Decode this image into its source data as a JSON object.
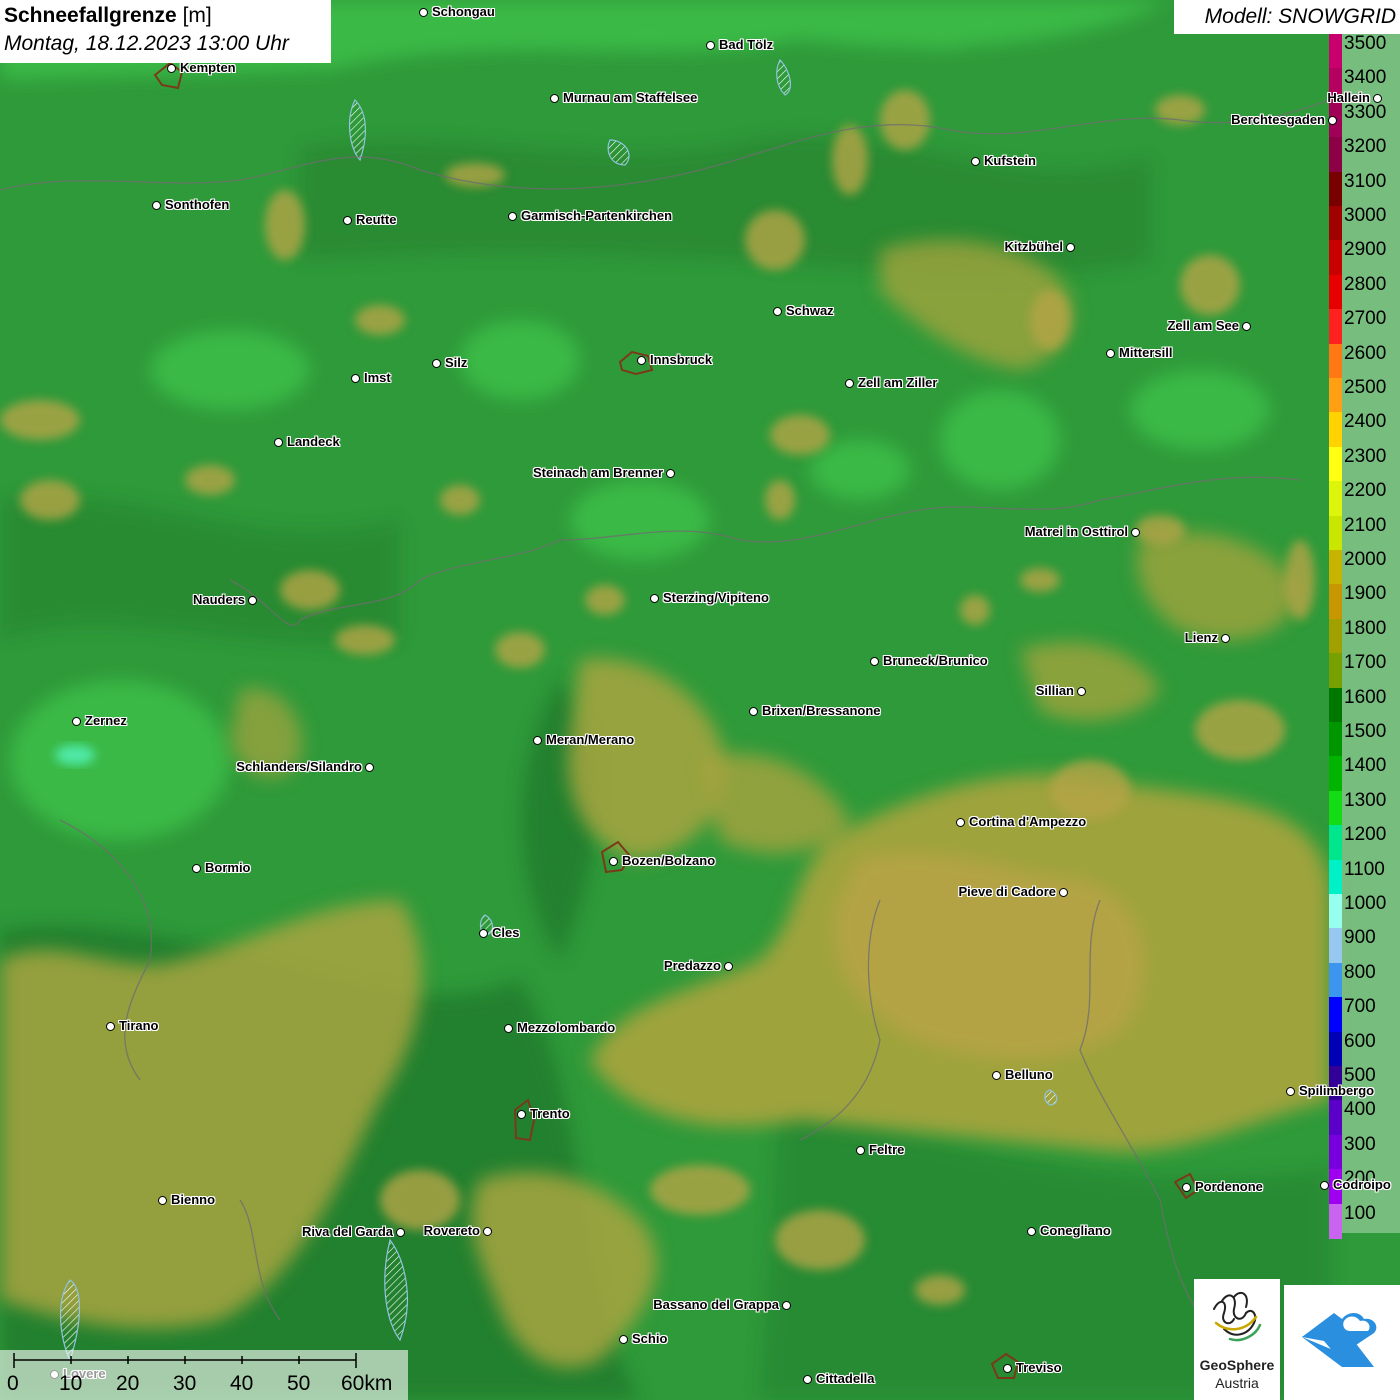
{
  "header": {
    "title": "Schneefallgrenze",
    "unit": "[m]",
    "datetime": "Montag, 18.12.2023 13:00 Uhr"
  },
  "model": {
    "label": "Modell: SNOWGRID"
  },
  "legend": {
    "items": [
      {
        "label": "3500",
        "color": "#c8006e"
      },
      {
        "label": "3400",
        "color": "#b4005f"
      },
      {
        "label": "3300",
        "color": "#a00055"
      },
      {
        "label": "3200",
        "color": "#8c0046"
      },
      {
        "label": "3100",
        "color": "#780000"
      },
      {
        "label": "3000",
        "color": "#a00000"
      },
      {
        "label": "2900",
        "color": "#c80000"
      },
      {
        "label": "2800",
        "color": "#e60000"
      },
      {
        "label": "2700",
        "color": "#ff2020"
      },
      {
        "label": "2600",
        "color": "#ff7814"
      },
      {
        "label": "2500",
        "color": "#ffa014"
      },
      {
        "label": "2400",
        "color": "#ffd200"
      },
      {
        "label": "2300",
        "color": "#ffff14"
      },
      {
        "label": "2200",
        "color": "#dcf50a"
      },
      {
        "label": "2100",
        "color": "#c8e600"
      },
      {
        "label": "2000",
        "color": "#c8b400"
      },
      {
        "label": "1900",
        "color": "#c89600"
      },
      {
        "label": "1800",
        "color": "#a0a000"
      },
      {
        "label": "1700",
        "color": "#78a000"
      },
      {
        "label": "1600",
        "color": "#007800"
      },
      {
        "label": "1500",
        "color": "#009600"
      },
      {
        "label": "1400",
        "color": "#00b400"
      },
      {
        "label": "1300",
        "color": "#14dc14"
      },
      {
        "label": "1200",
        "color": "#00e68c"
      },
      {
        "label": "1100",
        "color": "#00f0c8"
      },
      {
        "label": "1000",
        "color": "#96fff0"
      },
      {
        "label": "900",
        "color": "#96c8f0"
      },
      {
        "label": "800",
        "color": "#3c96f0"
      },
      {
        "label": "700",
        "color": "#0000ff"
      },
      {
        "label": "600",
        "color": "#0000b4"
      },
      {
        "label": "500",
        "color": "#320096"
      },
      {
        "label": "400",
        "color": "#5a00c8"
      },
      {
        "label": "300",
        "color": "#7800dc"
      },
      {
        "label": "200",
        "color": "#a000f0"
      },
      {
        "label": "100",
        "color": "#c864f0"
      }
    ]
  },
  "cities": [
    {
      "name": "Schongau",
      "label_side": "right"
    },
    {
      "name": "Bad Tölz",
      "label_side": "right"
    },
    {
      "name": "Kempten",
      "label_side": "right"
    },
    {
      "name": "Murnau am Staffelsee",
      "label_side": "right"
    },
    {
      "name": "Hallein",
      "label_side": "left"
    },
    {
      "name": "Berchtesgaden",
      "label_side": "left"
    },
    {
      "name": "Kufstein",
      "label_side": "right"
    },
    {
      "name": "Sonthofen",
      "label_side": "right"
    },
    {
      "name": "Reutte",
      "label_side": "right"
    },
    {
      "name": "Garmisch-Partenkirchen",
      "label_side": "right"
    },
    {
      "name": "Kitzbühel",
      "label_side": "left"
    },
    {
      "name": "Schwaz",
      "label_side": "right"
    },
    {
      "name": "Zell am See",
      "label_side": "left"
    },
    {
      "name": "Innsbruck",
      "label_side": "right"
    },
    {
      "name": "Mittersill",
      "label_side": "right"
    },
    {
      "name": "Silz",
      "label_side": "right"
    },
    {
      "name": "Imst",
      "label_side": "right"
    },
    {
      "name": "Zell am Ziller",
      "label_side": "right"
    },
    {
      "name": "Landeck",
      "label_side": "right"
    },
    {
      "name": "Steinach am Brenner",
      "label_side": "left"
    },
    {
      "name": "Matrei in Osttirol",
      "label_side": "left"
    },
    {
      "name": "Nauders",
      "label_side": "left"
    },
    {
      "name": "Sterzing/Vipiteno",
      "label_side": "right"
    },
    {
      "name": "Lienz",
      "label_side": "left"
    },
    {
      "name": "Bruneck/Brunico",
      "label_side": "right"
    },
    {
      "name": "Sillian",
      "label_side": "left"
    },
    {
      "name": "Brixen/Bressanone",
      "label_side": "right"
    },
    {
      "name": "Zernez",
      "label_side": "right"
    },
    {
      "name": "Meran/Merano",
      "label_side": "right"
    },
    {
      "name": "Schlanders/Silandro",
      "label_side": "left"
    },
    {
      "name": "Cortina d'Ampezzo",
      "label_side": "right"
    },
    {
      "name": "Bozen/Bolzano",
      "label_side": "right"
    },
    {
      "name": "Bormio",
      "label_side": "right"
    },
    {
      "name": "Pieve di Cadore",
      "label_side": "left"
    },
    {
      "name": "Cles",
      "label_side": "right"
    },
    {
      "name": "Predazzo",
      "label_side": "left"
    },
    {
      "name": "Tirano",
      "label_side": "right"
    },
    {
      "name": "Mezzolombardo",
      "label_side": "right"
    },
    {
      "name": "Belluno",
      "label_side": "right"
    },
    {
      "name": "Spilimbergo",
      "label_side": "right"
    },
    {
      "name": "Trento",
      "label_side": "right"
    },
    {
      "name": "Feltre",
      "label_side": "right"
    },
    {
      "name": "Pordenone",
      "label_side": "right"
    },
    {
      "name": "Codroipo",
      "label_side": "right"
    },
    {
      "name": "Bienno",
      "label_side": "right"
    },
    {
      "name": "Riva del Garda",
      "label_side": "left"
    },
    {
      "name": "Rovereto",
      "label_side": "left"
    },
    {
      "name": "Conegliano",
      "label_side": "right"
    },
    {
      "name": "Bassano del Grappa",
      "label_side": "left"
    },
    {
      "name": "Schio",
      "label_side": "right"
    },
    {
      "name": "Lovere",
      "label_side": "right"
    },
    {
      "name": "Treviso",
      "label_side": "right"
    },
    {
      "name": "Cittadella",
      "label_side": "right"
    }
  ],
  "scalebar": {
    "labels": [
      "0",
      "10",
      "20",
      "30",
      "40",
      "50",
      "60km"
    ]
  },
  "logos": {
    "geosphere_line1": "GeoSphere",
    "geosphere_line2": "Austria"
  },
  "colors": {
    "terrain_green": "#2f9a3a",
    "terrain_dark_green": "#237e2e",
    "terrain_light_green": "#3bbb45",
    "terrain_olive": "#a3a43c",
    "terrain_tan": "#b9a447",
    "lake": "#7fb5d8",
    "app_logo_blue": "#2b8fe0"
  }
}
